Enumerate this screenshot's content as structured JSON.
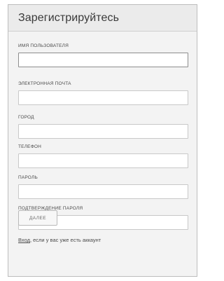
{
  "form": {
    "title": "Зарегистрируйтесь",
    "fields": [
      {
        "label": "ИМЯ ПОЛЬЗОВАТЕЛЯ",
        "value": ""
      },
      {
        "label": "ЭЛЕКТРОННАЯ ПОЧТА",
        "value": ""
      },
      {
        "label": "ГОРОД",
        "value": ""
      },
      {
        "label": "ТЕЛЕФОН",
        "value": ""
      },
      {
        "label": "ПАРОЛЬ",
        "value": ""
      },
      {
        "label": "ПОДТВЕРЖДЕНИЕ ПАРОЛЯ",
        "value": ""
      }
    ],
    "submit_label": "ДАЛЕЕ",
    "login_link": "Вход",
    "login_suffix": ", если у вас уже есть аккаунт"
  }
}
